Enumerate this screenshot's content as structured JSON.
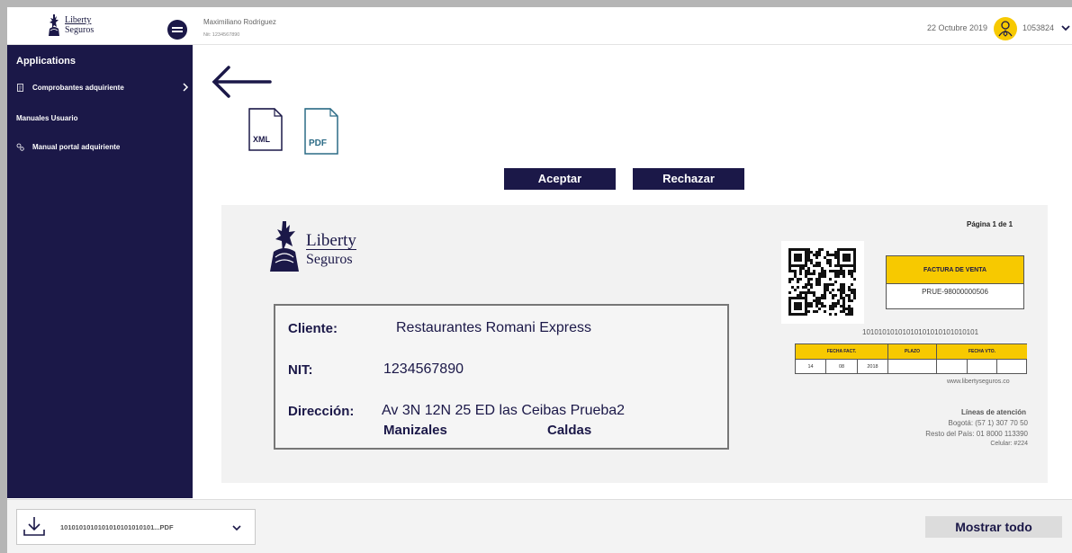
{
  "brand": {
    "logo_line1": "Liberty",
    "logo_line2": "Seguros",
    "navy": "#1b1848",
    "yellow": "#f7c900"
  },
  "header": {
    "user_name": "Maximiliano Rodriguez",
    "user_nit": "Nit: 1234567890",
    "date": "22 Octubre 2019",
    "user_code": "1053824",
    "icons": [
      "menu-toggle-icon",
      "user-avatar-icon",
      "chevron-down-icon"
    ]
  },
  "sidebar": {
    "title": "Applications",
    "items": [
      {
        "label": "Comprobantes adquiriente",
        "icon": "document-icon"
      },
      {
        "label": "Manual portal adquiriente",
        "icon": "gears-icon"
      }
    ],
    "section_label": "Manuales Usuario"
  },
  "main": {
    "accept_label": "Aceptar",
    "reject_label": "Rechazar",
    "xml_label": "XML",
    "pdf_label": "PDF",
    "icons": [
      "back-arrow-icon",
      "xml-file-icon",
      "pdf-file-icon"
    ]
  },
  "invoice": {
    "page_label": "Página 1 de 1",
    "logo_line1": "Liberty",
    "logo_line2": "Seguros",
    "client_label": "Cliente:",
    "client_value": "Restaurantes Romani Express",
    "nit_label": "NIT:",
    "nit_value": "1234567890",
    "address_label": "Dirección:",
    "address_value": "Av 3N 12N 25 ED las Ceibas Prueba2",
    "city": "Manizales",
    "department": "Caldas",
    "doc_type": "FACTURA DE VENTA",
    "doc_number": "PRUE-98000000506",
    "binary_code": "10101010101010101010101010101",
    "dates_headers": [
      "FECHA FACT.",
      "PLAZO",
      "FECHA VTO."
    ],
    "invoice_date": [
      "14",
      "08",
      "2018"
    ],
    "website": "www.libertyseguros.co",
    "contact_title": "Líneas de atención",
    "contact_lines": [
      "Bogotá: (57 1) 307 70 50",
      "Resto del País: 01 8000 113390",
      "Celular: #224"
    ]
  },
  "downloads": {
    "file_name": "1010101010101010101010101...PDF",
    "show_all_label": "Mostrar todo",
    "icons": [
      "download-icon",
      "chevron-down-icon"
    ]
  }
}
